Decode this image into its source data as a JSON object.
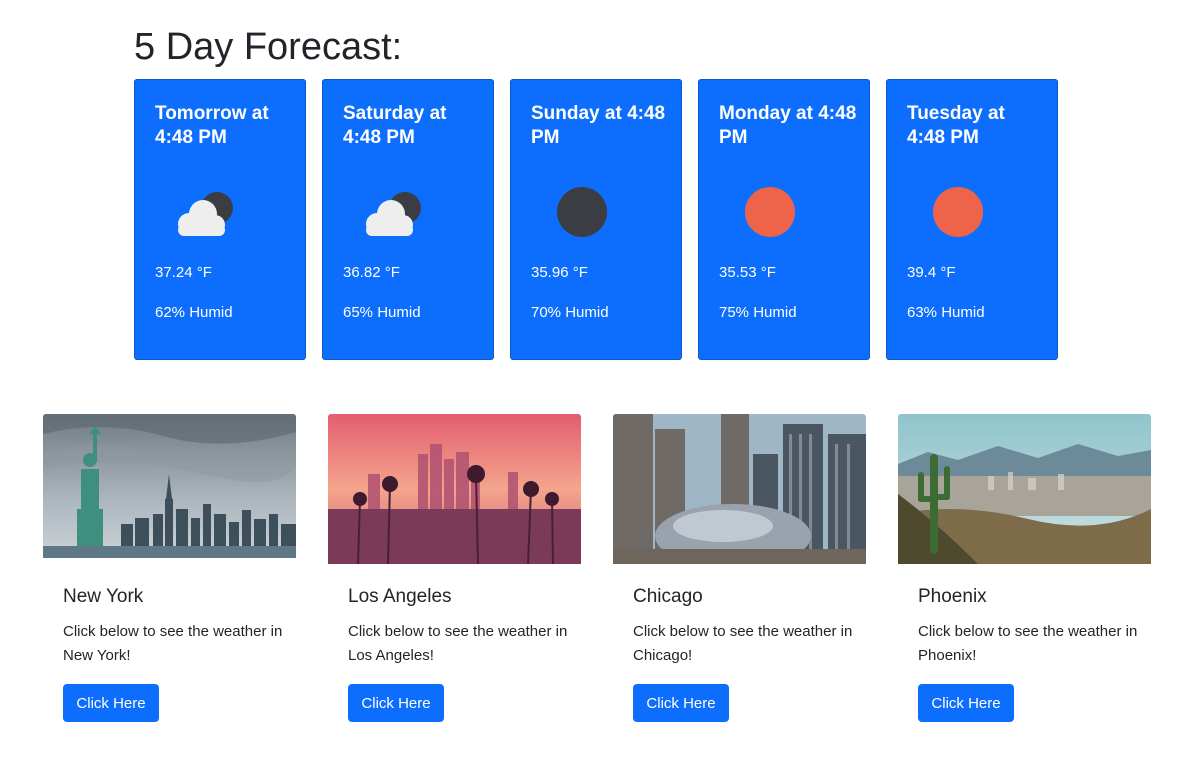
{
  "forecast": {
    "title": "5 Day Forecast:",
    "colors": {
      "card_bg": "#0d6efd",
      "sun": "#f0634b",
      "moon": "#3b3d42",
      "cloud": "#eeeeee"
    },
    "days": [
      {
        "label": "Tomorrow at 4:48 PM",
        "temp": "37.24 °F",
        "humidity": "62% Humid",
        "icon": "partly-cloudy-night-icon"
      },
      {
        "label": "Saturday at 4:48 PM",
        "temp": "36.82 °F",
        "humidity": "65% Humid",
        "icon": "partly-cloudy-night-icon"
      },
      {
        "label": "Sunday at 4:48 PM",
        "temp": "35.96 °F",
        "humidity": "70% Humid",
        "icon": "moon-icon"
      },
      {
        "label": "Monday at 4:48 PM",
        "temp": "35.53 °F",
        "humidity": "75% Humid",
        "icon": "sun-icon"
      },
      {
        "label": "Tuesday at 4:48 PM",
        "temp": "39.4 °F",
        "humidity": "63% Humid",
        "icon": "sun-icon"
      }
    ]
  },
  "cities": [
    {
      "name": "New York",
      "text": "Click below to see the weather in New York!",
      "button": "Click Here",
      "image": "new-york-skyline-image"
    },
    {
      "name": "Los Angeles",
      "text": "Click below to see the weather in Los Angeles!",
      "button": "Click Here",
      "image": "los-angeles-skyline-image"
    },
    {
      "name": "Chicago",
      "text": "Click below to see the weather in Chicago!",
      "button": "Click Here",
      "image": "chicago-bean-image"
    },
    {
      "name": "Phoenix",
      "text": "Click below to see the weather in Phoenix!",
      "button": "Click Here",
      "image": "phoenix-desert-image"
    }
  ]
}
